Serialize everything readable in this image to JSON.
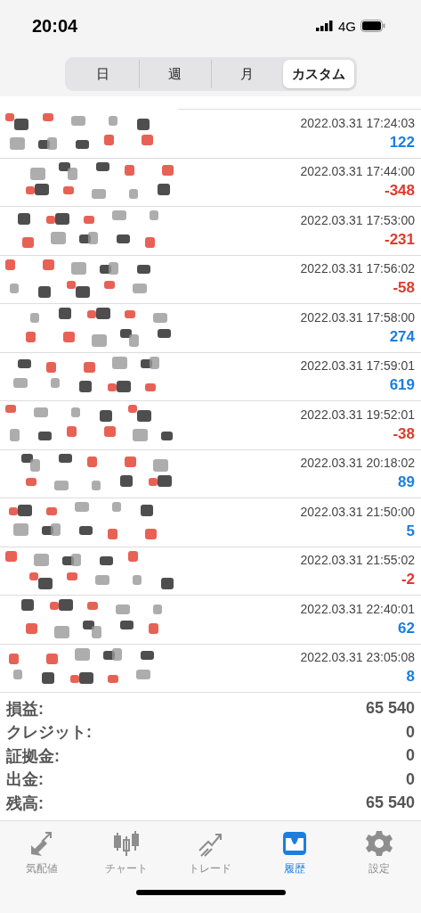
{
  "status_bar": {
    "time": "20:04",
    "network": "4G"
  },
  "periods": [
    {
      "label": "日",
      "selected": false
    },
    {
      "label": "週",
      "selected": false
    },
    {
      "label": "月",
      "selected": false
    },
    {
      "label": "カスタム",
      "selected": true
    }
  ],
  "deals": [
    {
      "kind": "picture",
      "time": "2022.03.31 17:24:03",
      "profit": "122",
      "color": "#1a7fe0"
    },
    {
      "kind": "picture",
      "time": "2022.03.31 17:44:00",
      "profit": "-348",
      "color": "#e0392b"
    },
    {
      "kind": "picture",
      "time": "2022.03.31 17:53:00",
      "profit": "-231",
      "color": "#e0392b"
    },
    {
      "kind": "picture",
      "time": "2022.03.31 17:56:02",
      "profit": "-58",
      "color": "#e0392b"
    },
    {
      "kind": "picture",
      "time": "2022.03.31 17:58:00",
      "profit": "274",
      "color": "#1a7fe0"
    },
    {
      "kind": "picture",
      "time": "2022.03.31 17:59:01",
      "profit": "619",
      "color": "#1a7fe0"
    },
    {
      "kind": "picture",
      "time": "2022.03.31 19:52:01",
      "profit": "-38",
      "color": "#e0392b"
    },
    {
      "kind": "picture",
      "time": "2022.03.31 20:18:02",
      "profit": "89",
      "color": "#1a7fe0"
    },
    {
      "kind": "picture",
      "time": "2022.03.31 21:50:00",
      "profit": "5",
      "color": "#1a7fe0"
    },
    {
      "kind": "picture",
      "time": "2022.03.31 21:55:02",
      "profit": "-2",
      "color": "#e0392b"
    },
    {
      "kind": "picture",
      "time": "2022.03.31 22:40:01",
      "profit": "62",
      "color": "#1a7fe0"
    },
    {
      "kind": "picture",
      "time": "2022.03.31 23:05:08",
      "profit": "8",
      "color": "#1a7fe0"
    }
  ],
  "summary": [
    {
      "label": "損益:",
      "value": "65 540"
    },
    {
      "label": "クレジット:",
      "value": "0"
    },
    {
      "label": "証拠金:",
      "value": "0"
    },
    {
      "label": "出金:",
      "value": "0"
    },
    {
      "label": "残高:",
      "value": "65 540"
    }
  ],
  "tab_bar": [
    {
      "kind": "quotes",
      "label": "気配値",
      "selected": false
    },
    {
      "kind": "chart",
      "label": "チャート",
      "selected": false
    },
    {
      "kind": "trade",
      "label": "トレード",
      "selected": false
    },
    {
      "kind": "history",
      "label": "履歴",
      "selected": true
    },
    {
      "kind": "settings",
      "label": "設定",
      "selected": false
    }
  ]
}
